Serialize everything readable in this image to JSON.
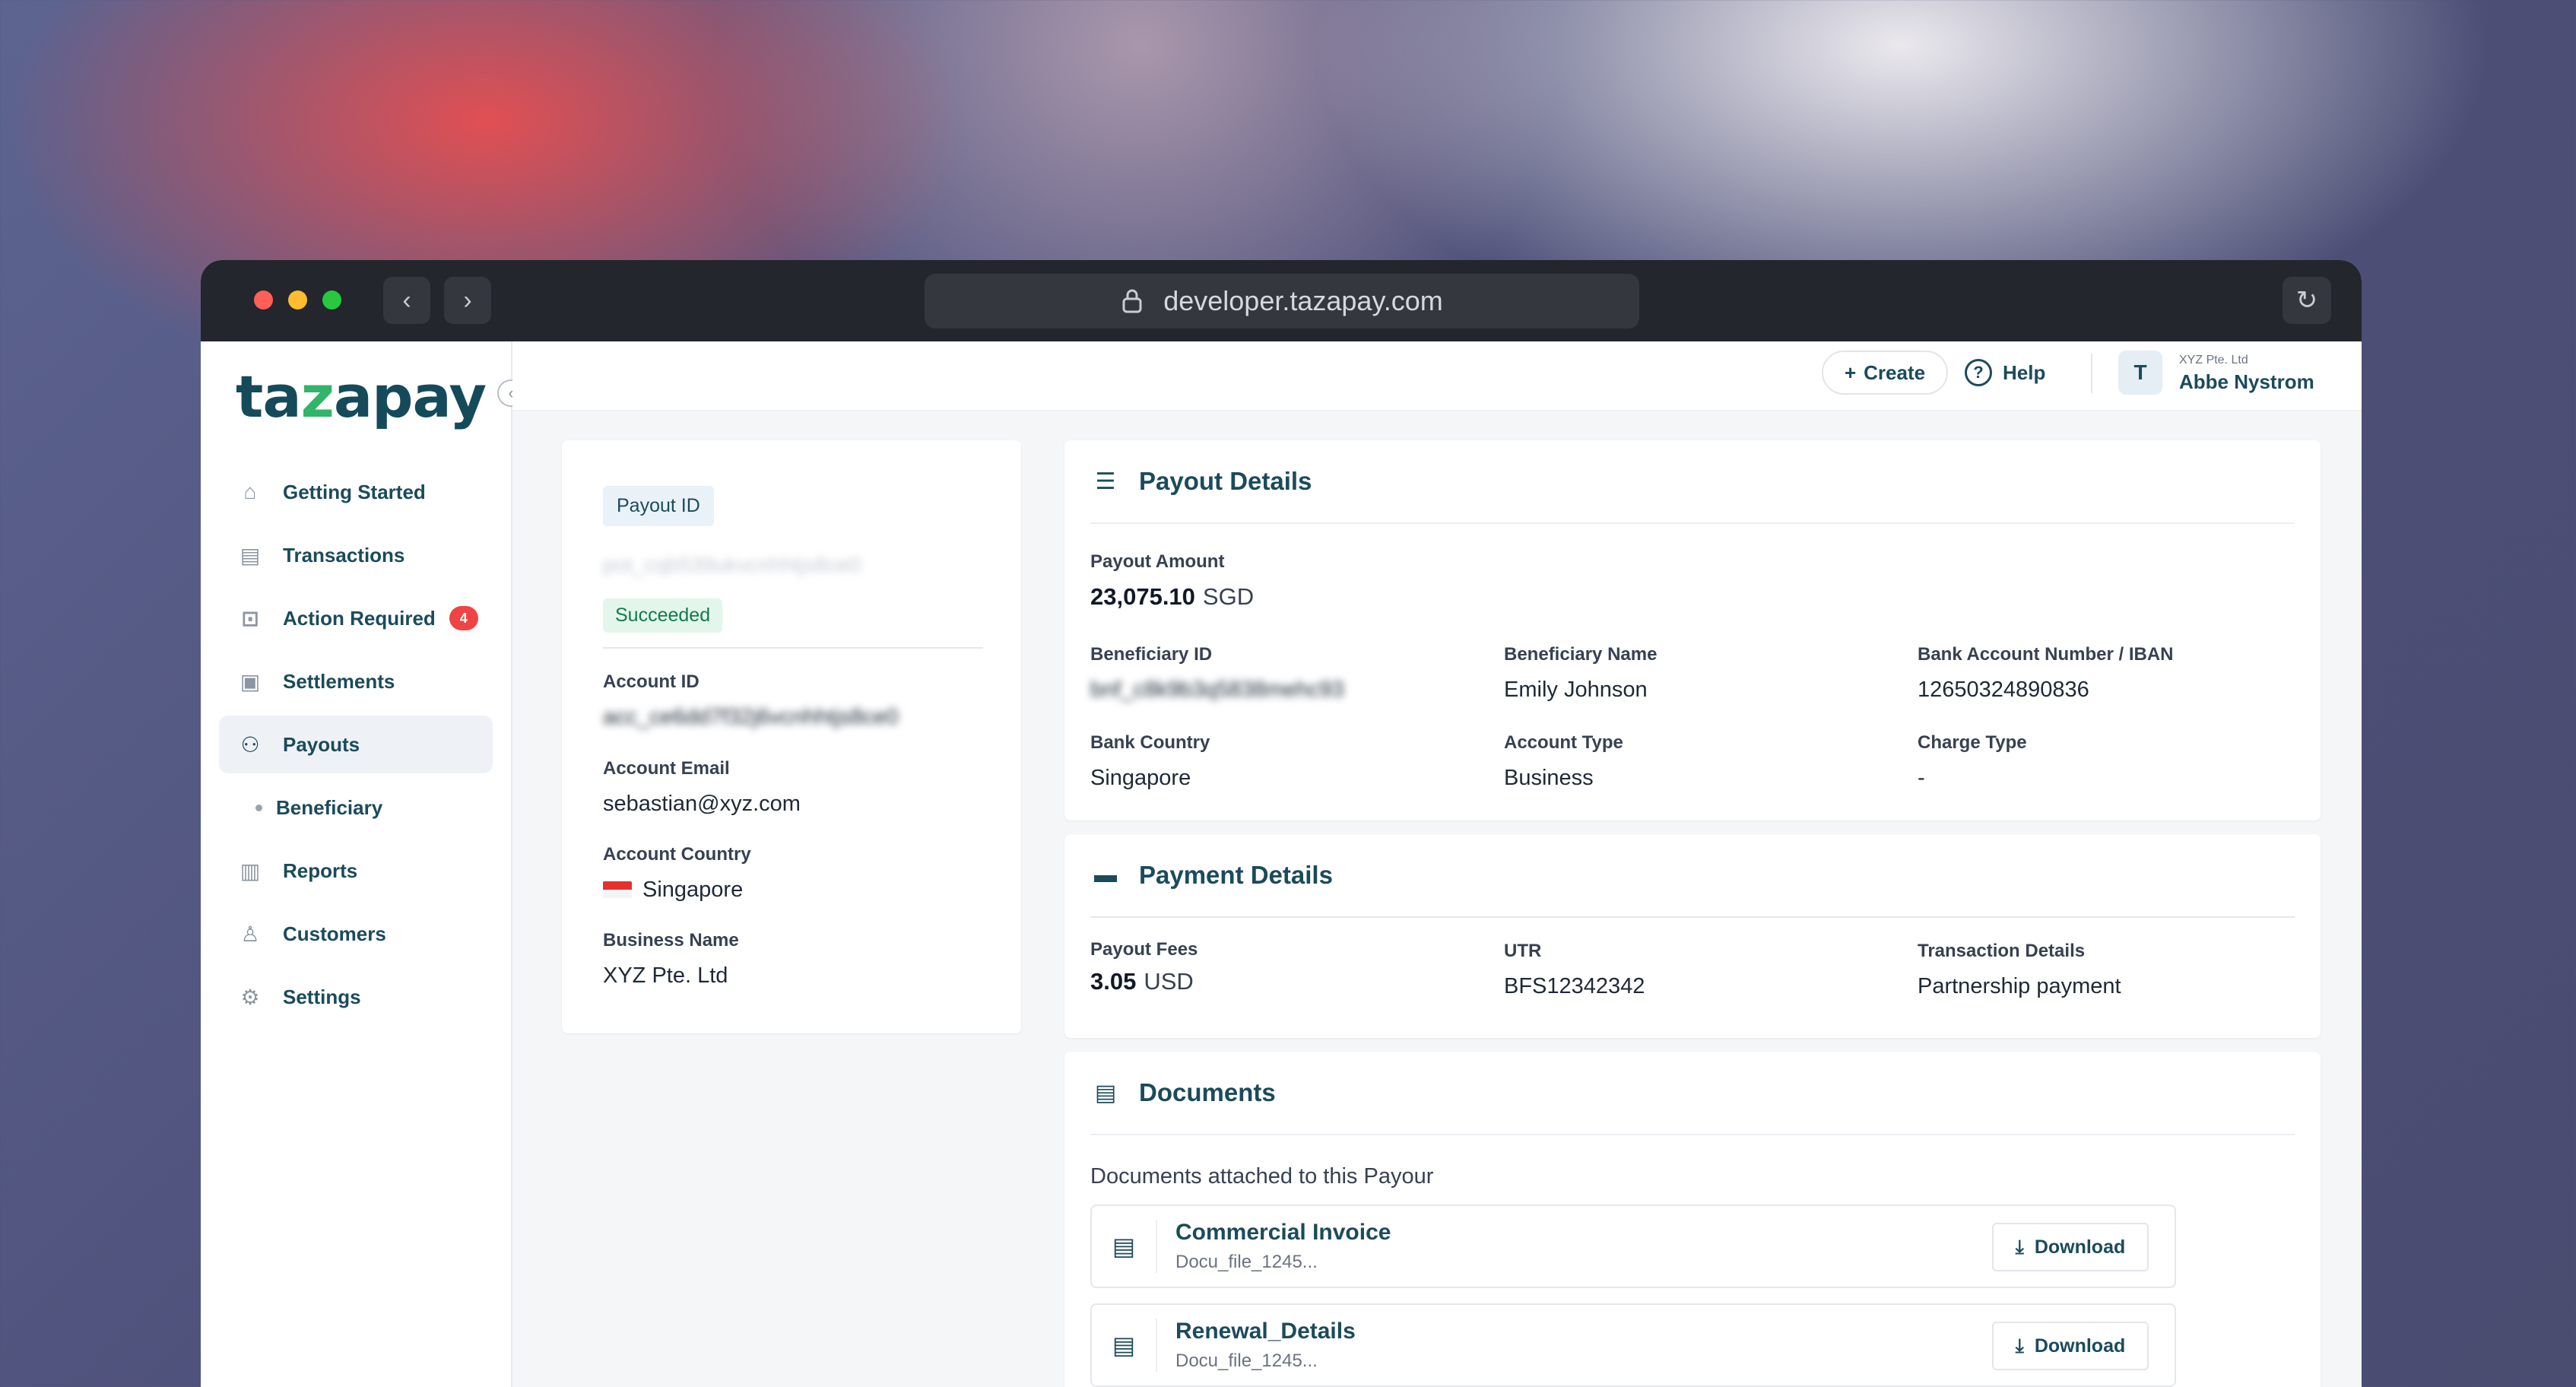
{
  "browser": {
    "url": "developer.tazapay.com",
    "back_icon": "‹",
    "forward_icon": "›",
    "reload_icon": "↻"
  },
  "logo": {
    "part1": "ta",
    "accent": "z",
    "part2": "apay"
  },
  "sidebar": {
    "items": [
      {
        "label": "Getting Started",
        "icon": "home-icon"
      },
      {
        "label": "Transactions",
        "icon": "list-icon"
      },
      {
        "label": "Action Required",
        "icon": "alert-icon",
        "badge": "4"
      },
      {
        "label": "Settlements",
        "icon": "settlement-icon"
      },
      {
        "label": "Payouts",
        "icon": "payout-icon",
        "active": true
      },
      {
        "label": "Beneficiary",
        "sub": true
      },
      {
        "label": "Reports",
        "icon": "chart-icon"
      },
      {
        "label": "Customers",
        "icon": "user-icon"
      },
      {
        "label": "Settings",
        "icon": "gear-icon"
      }
    ]
  },
  "topbar": {
    "create_label": "Create",
    "help_label": "Help",
    "avatar_initial": "T",
    "org": "XYZ Pte. Ltd",
    "user_name": "Abbe Nystrom"
  },
  "payout_summary": {
    "id_label": "Payout ID",
    "id_value": "pot_cqb539ukvcnhhtjs8ce0",
    "status": "Succeeded",
    "account_id_label": "Account ID",
    "account_id_value": "acc_ce6dd7f32j6vcnhhtjs8ce0",
    "account_email_label": "Account Email",
    "account_email_value": "sebastian@xyz.com",
    "account_country_label": "Account Country",
    "account_country_value": "Singapore",
    "business_name_label": "Business Name",
    "business_name_value": "XYZ Pte. Ltd"
  },
  "payout_details": {
    "title": "Payout Details",
    "amount_label": "Payout Amount",
    "amount_value": "23,075.10",
    "amount_currency": "SGD",
    "beneficiary_id_label": "Beneficiary ID",
    "beneficiary_id_value": "bnf_c8k9b3q5838mehc93",
    "beneficiary_name_label": "Beneficiary Name",
    "beneficiary_name_value": "Emily Johnson",
    "bank_account_label": "Bank Account Number / IBAN",
    "bank_account_value": "12650324890836",
    "bank_country_label": "Bank Country",
    "bank_country_value": "Singapore",
    "account_type_label": "Account Type",
    "account_type_value": "Business",
    "charge_type_label": "Charge Type",
    "charge_type_value": "-"
  },
  "payment_details": {
    "title": "Payment Details",
    "fees_label": "Payout Fees",
    "fees_value": "3.05",
    "fees_currency": "USD",
    "utr_label": "UTR",
    "utr_value": "BFS12342342",
    "txn_label": "Transaction Details",
    "txn_value": "Partnership payment"
  },
  "documents": {
    "title": "Documents",
    "intro": "Documents attached to this Payour",
    "download_label": "Download",
    "items": [
      {
        "name": "Commercial Invoice",
        "file": "Docu_file_1245..."
      },
      {
        "name": "Renewal_Details",
        "file": "Docu_file_1245..."
      }
    ]
  }
}
